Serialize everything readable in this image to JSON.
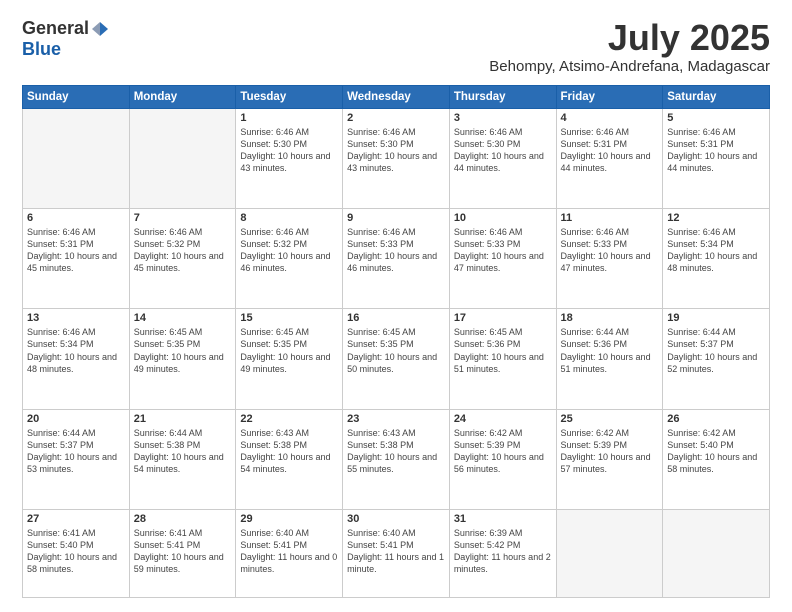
{
  "header": {
    "logo_general": "General",
    "logo_blue": "Blue",
    "month": "July 2025",
    "location": "Behompy, Atsimo-Andrefana, Madagascar"
  },
  "weekdays": [
    "Sunday",
    "Monday",
    "Tuesday",
    "Wednesday",
    "Thursday",
    "Friday",
    "Saturday"
  ],
  "weeks": [
    [
      {
        "day": "",
        "empty": true
      },
      {
        "day": "",
        "empty": true
      },
      {
        "day": "1",
        "sunrise": "6:46 AM",
        "sunset": "5:30 PM",
        "daylight": "10 hours and 43 minutes."
      },
      {
        "day": "2",
        "sunrise": "6:46 AM",
        "sunset": "5:30 PM",
        "daylight": "10 hours and 43 minutes."
      },
      {
        "day": "3",
        "sunrise": "6:46 AM",
        "sunset": "5:30 PM",
        "daylight": "10 hours and 44 minutes."
      },
      {
        "day": "4",
        "sunrise": "6:46 AM",
        "sunset": "5:31 PM",
        "daylight": "10 hours and 44 minutes."
      },
      {
        "day": "5",
        "sunrise": "6:46 AM",
        "sunset": "5:31 PM",
        "daylight": "10 hours and 44 minutes."
      }
    ],
    [
      {
        "day": "6",
        "sunrise": "6:46 AM",
        "sunset": "5:31 PM",
        "daylight": "10 hours and 45 minutes."
      },
      {
        "day": "7",
        "sunrise": "6:46 AM",
        "sunset": "5:32 PM",
        "daylight": "10 hours and 45 minutes."
      },
      {
        "day": "8",
        "sunrise": "6:46 AM",
        "sunset": "5:32 PM",
        "daylight": "10 hours and 46 minutes."
      },
      {
        "day": "9",
        "sunrise": "6:46 AM",
        "sunset": "5:33 PM",
        "daylight": "10 hours and 46 minutes."
      },
      {
        "day": "10",
        "sunrise": "6:46 AM",
        "sunset": "5:33 PM",
        "daylight": "10 hours and 47 minutes."
      },
      {
        "day": "11",
        "sunrise": "6:46 AM",
        "sunset": "5:33 PM",
        "daylight": "10 hours and 47 minutes."
      },
      {
        "day": "12",
        "sunrise": "6:46 AM",
        "sunset": "5:34 PM",
        "daylight": "10 hours and 48 minutes."
      }
    ],
    [
      {
        "day": "13",
        "sunrise": "6:46 AM",
        "sunset": "5:34 PM",
        "daylight": "10 hours and 48 minutes."
      },
      {
        "day": "14",
        "sunrise": "6:45 AM",
        "sunset": "5:35 PM",
        "daylight": "10 hours and 49 minutes."
      },
      {
        "day": "15",
        "sunrise": "6:45 AM",
        "sunset": "5:35 PM",
        "daylight": "10 hours and 49 minutes."
      },
      {
        "day": "16",
        "sunrise": "6:45 AM",
        "sunset": "5:35 PM",
        "daylight": "10 hours and 50 minutes."
      },
      {
        "day": "17",
        "sunrise": "6:45 AM",
        "sunset": "5:36 PM",
        "daylight": "10 hours and 51 minutes."
      },
      {
        "day": "18",
        "sunrise": "6:44 AM",
        "sunset": "5:36 PM",
        "daylight": "10 hours and 51 minutes."
      },
      {
        "day": "19",
        "sunrise": "6:44 AM",
        "sunset": "5:37 PM",
        "daylight": "10 hours and 52 minutes."
      }
    ],
    [
      {
        "day": "20",
        "sunrise": "6:44 AM",
        "sunset": "5:37 PM",
        "daylight": "10 hours and 53 minutes."
      },
      {
        "day": "21",
        "sunrise": "6:44 AM",
        "sunset": "5:38 PM",
        "daylight": "10 hours and 54 minutes."
      },
      {
        "day": "22",
        "sunrise": "6:43 AM",
        "sunset": "5:38 PM",
        "daylight": "10 hours and 54 minutes."
      },
      {
        "day": "23",
        "sunrise": "6:43 AM",
        "sunset": "5:38 PM",
        "daylight": "10 hours and 55 minutes."
      },
      {
        "day": "24",
        "sunrise": "6:42 AM",
        "sunset": "5:39 PM",
        "daylight": "10 hours and 56 minutes."
      },
      {
        "day": "25",
        "sunrise": "6:42 AM",
        "sunset": "5:39 PM",
        "daylight": "10 hours and 57 minutes."
      },
      {
        "day": "26",
        "sunrise": "6:42 AM",
        "sunset": "5:40 PM",
        "daylight": "10 hours and 58 minutes."
      }
    ],
    [
      {
        "day": "27",
        "sunrise": "6:41 AM",
        "sunset": "5:40 PM",
        "daylight": "10 hours and 58 minutes."
      },
      {
        "day": "28",
        "sunrise": "6:41 AM",
        "sunset": "5:41 PM",
        "daylight": "10 hours and 59 minutes."
      },
      {
        "day": "29",
        "sunrise": "6:40 AM",
        "sunset": "5:41 PM",
        "daylight": "11 hours and 0 minutes."
      },
      {
        "day": "30",
        "sunrise": "6:40 AM",
        "sunset": "5:41 PM",
        "daylight": "11 hours and 1 minute."
      },
      {
        "day": "31",
        "sunrise": "6:39 AM",
        "sunset": "5:42 PM",
        "daylight": "11 hours and 2 minutes."
      },
      {
        "day": "",
        "empty": true
      },
      {
        "day": "",
        "empty": true
      }
    ]
  ]
}
